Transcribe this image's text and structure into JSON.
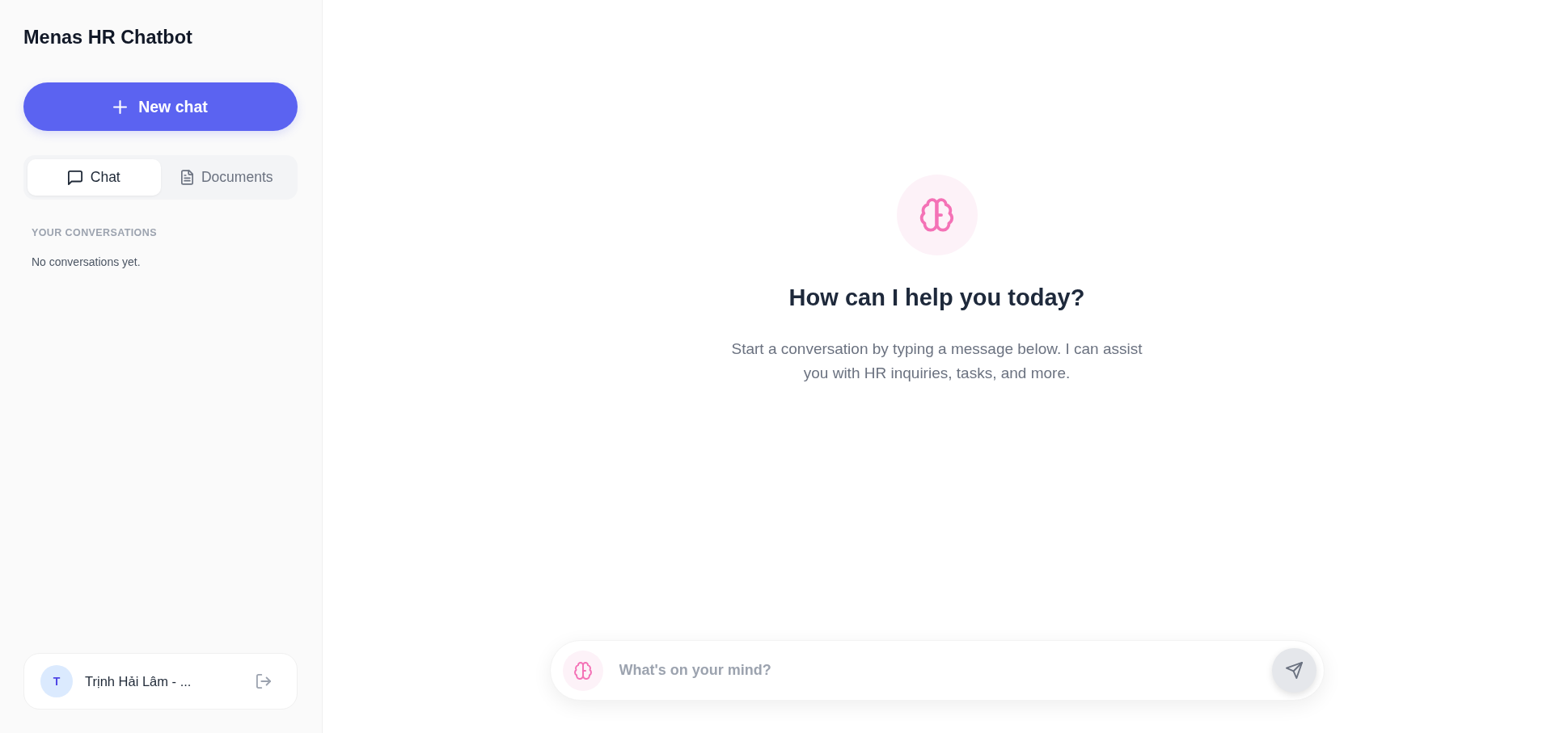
{
  "sidebar": {
    "title": "Menas HR Chatbot",
    "new_chat_button": {
      "label": "New chat"
    },
    "tabs": [
      {
        "kind": "chat",
        "label": "Chat",
        "selected": true
      },
      {
        "kind": "documents",
        "label": "Documents",
        "selected": false
      }
    ],
    "conversations": {
      "heading": "YOUR CONVERSATIONS",
      "empty_text": "No conversations yet."
    },
    "user": {
      "avatar_initial": "T",
      "name": "Trịnh Hải Lâm - ..."
    }
  },
  "main": {
    "heading": "How can I help you today?",
    "description": "Start a conversation by typing a message below. I can assist you with HR inquiries, tasks, and more.",
    "composer": {
      "placeholder": "What's on your mind?"
    }
  }
}
